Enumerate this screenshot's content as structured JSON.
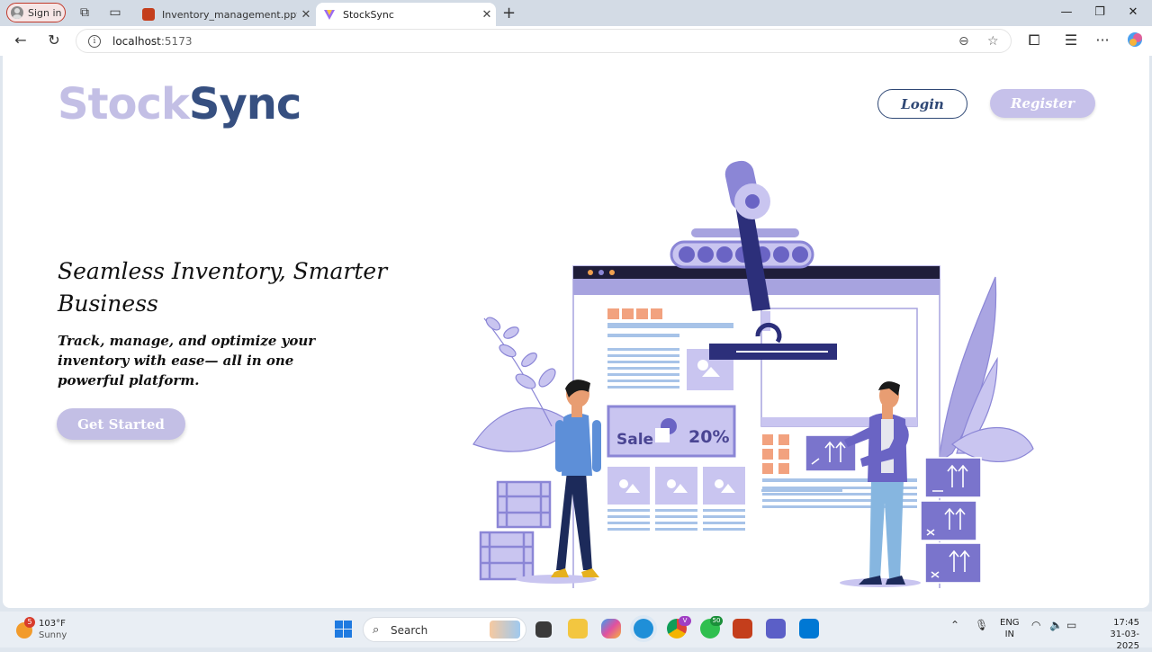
{
  "browser": {
    "signin_label": "Sign in",
    "tabs": [
      {
        "title": "Inventory_management.pptx - Mi",
        "active": false
      },
      {
        "title": "StockSync",
        "active": true
      }
    ],
    "url_host": "localhost",
    "url_port": ":5173"
  },
  "page": {
    "logo_part1": "Stock",
    "logo_part2": "Sync",
    "login_label": "Login",
    "register_label": "Register",
    "headline": "Seamless Inventory, Smarter Business",
    "subheadline": "Track, manage, and optimize your inventory with ease— all in one powerful platform.",
    "cta_label": "Get Started",
    "illustration": {
      "sale_text": "Sale",
      "discount_text": "20%"
    },
    "colors": {
      "logo_light": "#c3bfe5",
      "logo_dark": "#364f80",
      "accent": "#c6c1ea",
      "illustration_purple": "#8b86d6",
      "illustration_navy": "#2c2f7a"
    }
  },
  "taskbar": {
    "weather_badge": "5",
    "weather_temp": "103°F",
    "weather_condition": "Sunny",
    "search_label": "Search",
    "whatsapp_badge": "50",
    "lang_line1": "ENG",
    "lang_line2": "IN",
    "time": "17:45",
    "date": "31-03-2025"
  }
}
